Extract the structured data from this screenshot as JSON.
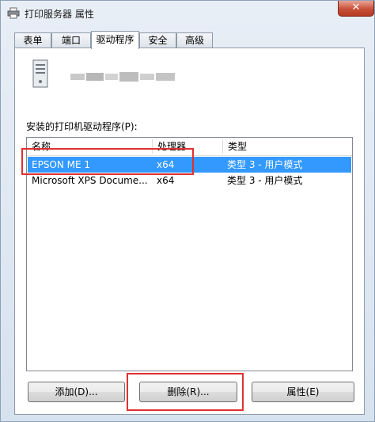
{
  "window": {
    "title": "打印服务器 属性",
    "close_glyph": "✕"
  },
  "tabs": [
    {
      "label": "表单",
      "active": false
    },
    {
      "label": "端口",
      "active": false
    },
    {
      "label": "驱动程序",
      "active": true
    },
    {
      "label": "安全",
      "active": false
    },
    {
      "label": "高级",
      "active": false
    }
  ],
  "drivers": {
    "list_label": "安装的打印机驱动程序(P):",
    "columns": [
      "名称",
      "处理器",
      "类型"
    ],
    "rows": [
      {
        "name": "EPSON ME 1",
        "processor": "x64",
        "type": "类型 3 - 用户模式",
        "selected": true
      },
      {
        "name": "Microsoft XPS Docume...",
        "processor": "x64",
        "type": "类型 3 - 用户模式",
        "selected": false
      }
    ]
  },
  "buttons": {
    "add": "添加(D)...",
    "remove": "删除(R)...",
    "properties": "属性(E)"
  },
  "colors": {
    "selection": "#3399ff",
    "highlight_box": "#e03030",
    "close": "#c8503a"
  },
  "icons": {
    "title": "printer-icon",
    "server": "server-icon",
    "close": "close-icon"
  }
}
